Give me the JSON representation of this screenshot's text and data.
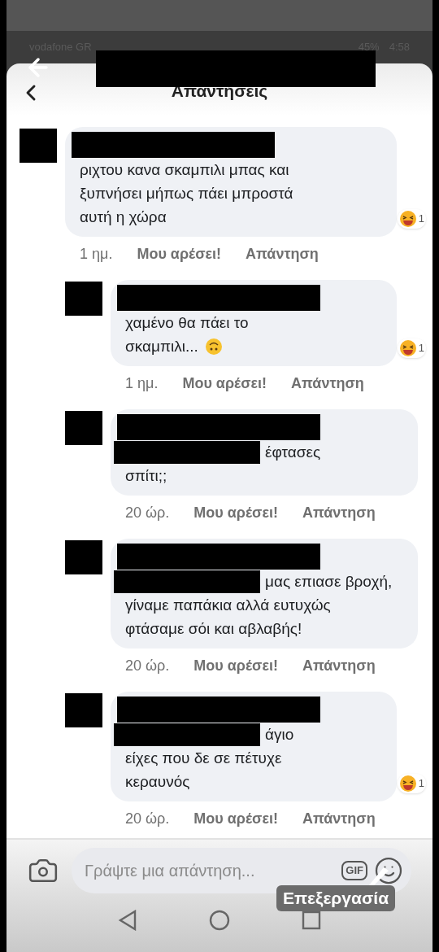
{
  "status_bar": {
    "carrier": "vodafone GR",
    "battery": "45%",
    "time": "4:58"
  },
  "header": {
    "title": "Απαντήσεις"
  },
  "comments": [
    {
      "inline_redaction": false,
      "lines": [
        "ριχτου κανα σκαμπιλι μπας και",
        "ξυπνήσει μήπως πάει μπροστά",
        "αυτή η χώρα"
      ],
      "end_emoji": false,
      "reaction": {
        "count": "1"
      },
      "time": "1 ημ.",
      "like": "Μου αρέσει!",
      "reply": "Απάντηση",
      "children": [
        {
          "inline_redaction": false,
          "lines": [
            "χαμένο θα πάει το",
            "σκαμπιλι..."
          ],
          "end_emoji": true,
          "reaction": {
            "count": "1"
          },
          "time": "1 ημ.",
          "like": "Μου αρέσει!",
          "reply": "Απάντηση"
        },
        {
          "inline_redaction": true,
          "lines": [
            "έφτασες",
            "σπίτι;;"
          ],
          "end_emoji": false,
          "time": "20 ώρ.",
          "like": "Μου αρέσει!",
          "reply": "Απάντηση"
        },
        {
          "inline_redaction": true,
          "lines": [
            "μας επιασε βροχή,",
            "γίναμε παπάκια αλλά ευτυχώς",
            "φτάσαμε σόι και αβλαβής!"
          ],
          "end_emoji": false,
          "time": "20 ώρ.",
          "like": "Μου αρέσει!",
          "reply": "Απάντηση"
        },
        {
          "inline_redaction": true,
          "lines": [
            "άγιο",
            "είχες που δε σε πέτυχε",
            "κεραυνός"
          ],
          "end_emoji": false,
          "reaction": {
            "count": "1"
          },
          "time": "20 ώρ.",
          "like": "Μου αρέσει!",
          "reply": "Απάντηση"
        }
      ]
    }
  ],
  "composer": {
    "placeholder": "Γράψτε μια απάντηση...",
    "gif": "GIF"
  },
  "overlay": {
    "edit_label": "Επεξεργασία"
  }
}
